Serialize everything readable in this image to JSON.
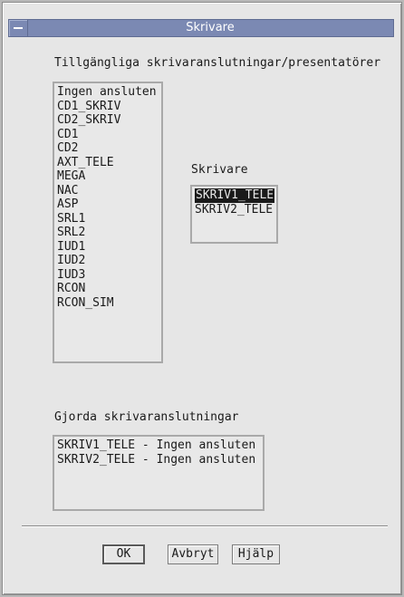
{
  "window": {
    "title": "Skrivare"
  },
  "available": {
    "label": "Tillgängliga skrivaranslutningar/presentatörer",
    "items": [
      "Ingen ansluten",
      "CD1_SKRIV",
      "CD2_SKRIV",
      "CD1",
      "CD2",
      "AXT_TELE",
      "MEGA",
      "NAC",
      "ASP",
      "SRL1",
      "SRL2",
      "IUD1",
      "IUD2",
      "IUD3",
      "RCON",
      "RCON_SIM"
    ]
  },
  "printers": {
    "label": "Skrivare",
    "items": [
      "SKRIV1_TELE",
      "SKRIV2_TELE"
    ],
    "selected": "SKRIV1_TELE"
  },
  "made": {
    "label": "Gjorda skrivaranslutningar",
    "items": [
      "SKRIV1_TELE - Ingen ansluten",
      "SKRIV2_TELE - Ingen ansluten"
    ]
  },
  "buttons": {
    "ok": "OK",
    "cancel": "Avbryt",
    "help": "Hjälp"
  },
  "icons": {
    "window_menu": "window-menu-icon"
  }
}
